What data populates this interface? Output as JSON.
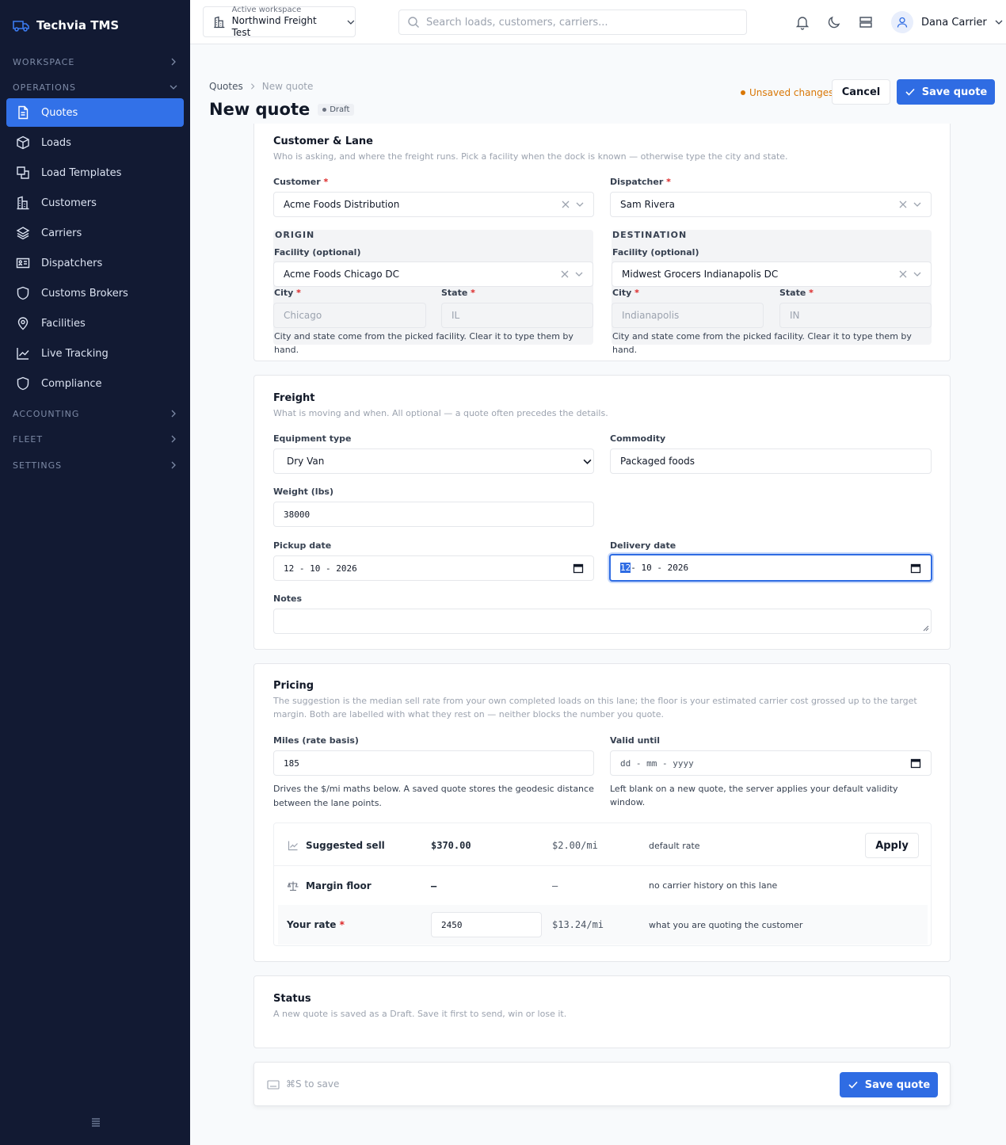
{
  "app": {
    "name": "Techvia TMS"
  },
  "sidebar": {
    "sections": {
      "workspace": "WORKSPACE",
      "operations": "OPERATIONS",
      "accounting": "ACCOUNTING",
      "fleet": "FLEET",
      "settings": "SETTINGS"
    },
    "items": [
      {
        "label": "Quotes",
        "icon": "file-icon",
        "active": true
      },
      {
        "label": "Loads",
        "icon": "box-icon"
      },
      {
        "label": "Load Templates",
        "icon": "templates-icon"
      },
      {
        "label": "Customers",
        "icon": "building-icon"
      },
      {
        "label": "Carriers",
        "icon": "layers-icon"
      },
      {
        "label": "Dispatchers",
        "icon": "id-card-icon"
      },
      {
        "label": "Customs Brokers",
        "icon": "shield-icon"
      },
      {
        "label": "Facilities",
        "icon": "map-pin-icon"
      },
      {
        "label": "Live Tracking",
        "icon": "chart-line-icon"
      },
      {
        "label": "Compliance",
        "icon": "shield-icon"
      }
    ]
  },
  "topbar": {
    "workspace_label": "Active workspace",
    "workspace_name": "Northwind Freight Test",
    "search_placeholder": "Search loads, customers, carriers...",
    "user_name": "Dana Carrier"
  },
  "header": {
    "breadcrumb": [
      "Quotes",
      "New quote"
    ],
    "title": "New quote",
    "status_badge": "Draft",
    "unsaved": "Unsaved changes",
    "cancel": "Cancel",
    "save": "Save quote"
  },
  "customer_lane": {
    "title": "Customer & Lane",
    "subtitle": "Who is asking, and where the freight runs. Pick a facility when the dock is known — otherwise type the city and state.",
    "customer_label": "Customer",
    "customer_value": "Acme Foods Distribution",
    "dispatcher_label": "Dispatcher",
    "dispatcher_value": "Sam Rivera",
    "origin": {
      "title": "ORIGIN",
      "facility_label": "Facility (optional)",
      "facility_value": "Acme Foods Chicago DC",
      "city_label": "City",
      "city_value": "Chicago",
      "state_label": "State",
      "state_value": "IL",
      "hint": "City and state come from the picked facility. Clear it to type them by hand."
    },
    "destination": {
      "title": "DESTINATION",
      "facility_label": "Facility (optional)",
      "facility_value": "Midwest Grocers Indianapolis DC",
      "city_label": "City",
      "city_value": "Indianapolis",
      "state_label": "State",
      "state_value": "IN",
      "hint": "City and state come from the picked facility. Clear it to type them by hand."
    }
  },
  "freight": {
    "title": "Freight",
    "subtitle": "What is moving and when. All optional — a quote often precedes the details.",
    "equipment_label": "Equipment type",
    "equipment_value": "Dry Van",
    "commodity_label": "Commodity",
    "commodity_value": "Packaged foods",
    "weight_label": "Weight (lbs)",
    "weight_value": "38000",
    "pickup_label": "Pickup date",
    "pickup_value": "12 - 10 - 2026",
    "delivery_label": "Delivery date",
    "delivery_day": "12",
    "delivery_rest": " - 10 - 2026",
    "notes_label": "Notes"
  },
  "pricing": {
    "title": "Pricing",
    "subtitle": "The suggestion is the median sell rate from your own completed loads on this lane; the floor is your estimated carrier cost grossed up to the target margin. Both are labelled with what they rest on — neither blocks the number you quote.",
    "miles_label": "Miles (rate basis)",
    "miles_value": "185",
    "miles_hint": "Drives the $/mi maths below. A saved quote stores the geodesic distance between the lane points.",
    "valid_label": "Valid until",
    "valid_placeholder": "dd - mm - yyyy",
    "valid_hint": "Left blank on a new quote, the server applies your default validity window.",
    "rows": {
      "suggested": {
        "label": "Suggested sell",
        "amount": "$370.00",
        "per_mile": "$2.00/mi",
        "basis": "default rate",
        "action": "Apply"
      },
      "floor": {
        "label": "Margin floor",
        "amount": "—",
        "per_mile": "—",
        "basis": "no carrier history on this lane"
      },
      "rate": {
        "label": "Your rate",
        "value": "2450",
        "per_mile": "$13.24/mi",
        "basis": "what you are quoting the customer"
      }
    }
  },
  "status": {
    "title": "Status",
    "subtitle": "A new quote is saved as a Draft. Save it first to send, win or lose it."
  },
  "footer": {
    "shortcut": "⌘S to save",
    "save": "Save quote"
  },
  "colors": {
    "sidebar_bg": "#121a33",
    "accent": "#2f6ce3",
    "warning": "#d97706",
    "required": "#dc2626"
  }
}
